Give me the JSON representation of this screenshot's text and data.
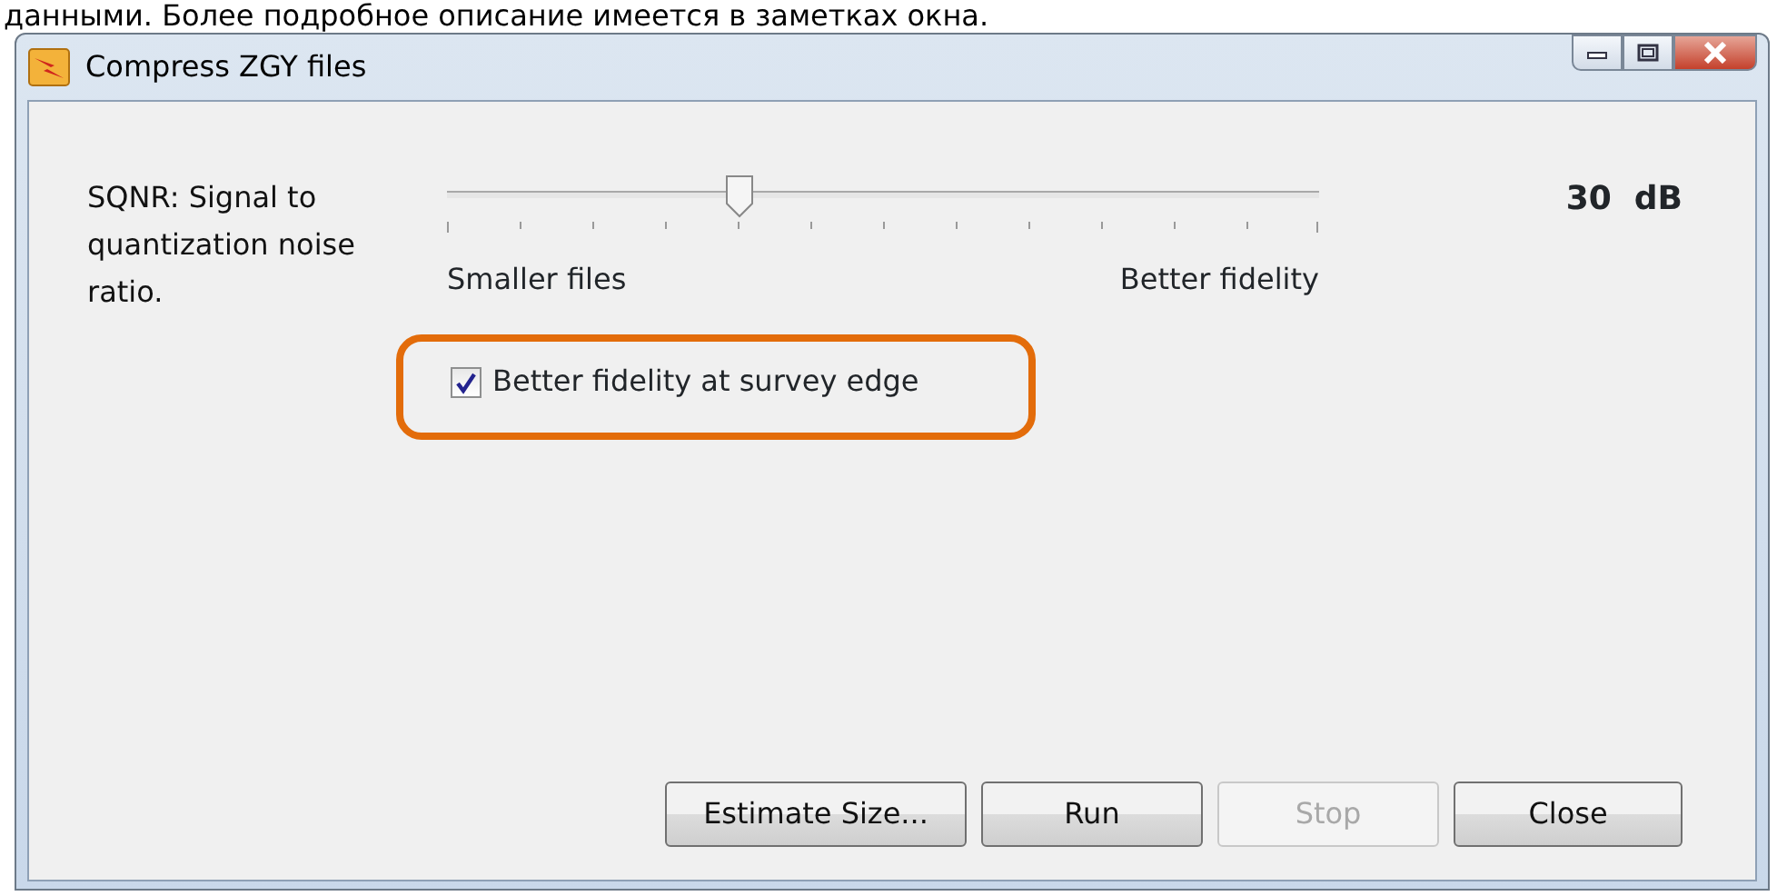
{
  "caption": "данными. Более подробное описание имеется в заметках окна.",
  "window": {
    "title": "Compress ZGY files"
  },
  "sqnr": {
    "label": "SQNR: Signal to quantization noise ratio.",
    "level": 0.33,
    "min_label": "Smaller files",
    "max_label": "Better fidelity",
    "reading": "30  dB"
  },
  "checkbox": {
    "label": "Better fidelity at survey edge",
    "checked": true,
    "highlighted": true
  },
  "buttons": [
    {
      "label": "Estimate Size...",
      "disabled": false
    },
    {
      "label": "Run",
      "disabled": false
    },
    {
      "label": "Stop",
      "disabled": true
    },
    {
      "label": "Close",
      "disabled": false
    }
  ]
}
